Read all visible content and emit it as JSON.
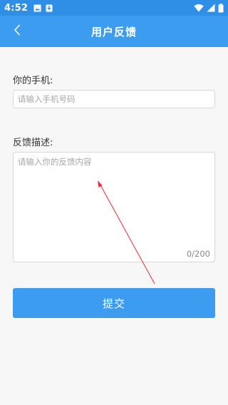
{
  "status_bar": {
    "time": "4:52",
    "left_icons": [
      "image-icon",
      "download-icon"
    ],
    "right_icons": [
      "wifi-icon",
      "signal-icon",
      "battery-icon"
    ]
  },
  "app_bar": {
    "title": "用户反馈",
    "back_icon": "chevron-left-icon"
  },
  "form": {
    "phone": {
      "label": "你的手机:",
      "placeholder": "请输入手机号码",
      "value": ""
    },
    "description": {
      "label": "反馈描述:",
      "placeholder": "请输入你的反馈内容",
      "value": "",
      "counter": "0/200"
    },
    "submit_label": "提交"
  },
  "colors": {
    "status_bar": "#2f8fe6",
    "primary": "#3b9cf0",
    "background": "#f7f7f7",
    "annotation": "#e0303a"
  }
}
